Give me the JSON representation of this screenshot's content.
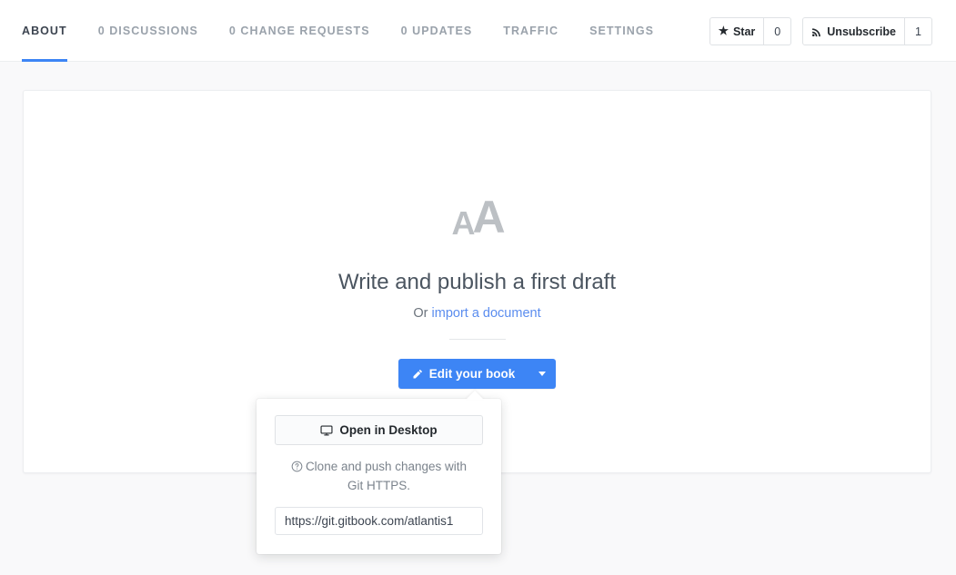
{
  "header": {
    "tabs": [
      {
        "label": "ABOUT",
        "active": true,
        "name": "tab-about"
      },
      {
        "label": "0 DISCUSSIONS",
        "active": false,
        "name": "tab-discussions"
      },
      {
        "label": "0 CHANGE REQUESTS",
        "active": false,
        "name": "tab-change-requests"
      },
      {
        "label": "0 UPDATES",
        "active": false,
        "name": "tab-updates"
      },
      {
        "label": "TRAFFIC",
        "active": false,
        "name": "tab-traffic"
      },
      {
        "label": "SETTINGS",
        "active": false,
        "name": "tab-settings"
      }
    ],
    "star_button": {
      "icon": "star-icon",
      "icon_glyph": "★",
      "label": "Star",
      "count": "0"
    },
    "unsubscribe_button": {
      "icon": "rss-icon",
      "label": "Unsubscribe",
      "count": "1"
    }
  },
  "main": {
    "empty_state": {
      "icon": "double-a-typography-icon",
      "icon_text_small": "A",
      "icon_text_large": "A",
      "title": "Write and publish a first draft",
      "subtitle_prefix": "Or ",
      "subtitle_link": "import a document"
    },
    "edit_button": {
      "icon": "pencil-icon",
      "label": "Edit your book",
      "caret_icon": "chevron-down-icon"
    }
  },
  "popover": {
    "open_in_desktop": {
      "icon": "desktop-monitor-icon",
      "label": "Open in Desktop"
    },
    "help": {
      "icon": "question-circle-icon",
      "text": "Clone and push changes with Git HTTPS."
    },
    "url_field": {
      "value": "https://git.gitbook.com/atlantis1",
      "placeholder": "https://git.gitbook.com/atlantis1"
    }
  },
  "colors": {
    "accent_blue": "#3d85f5",
    "link_blue": "#5b8def",
    "page_bg": "#f9f9fa",
    "card_bg": "#ffffff",
    "muted_text": "#9aa2ab",
    "icon_gray": "#bcc0c4"
  }
}
